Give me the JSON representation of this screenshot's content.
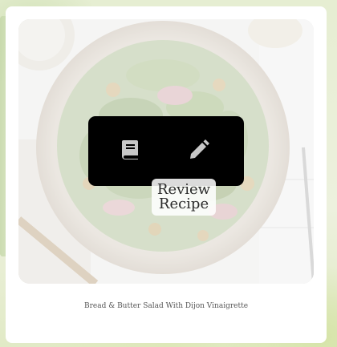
{
  "recipe": {
    "title": "Bread & Butter Salad With Dijon Vinaigrette"
  },
  "actions": {
    "review": {
      "icon": "book-icon",
      "tooltip_line1": "Review",
      "tooltip_line2": "Recipe"
    },
    "edit": {
      "icon": "pencil-icon"
    }
  },
  "colors": {
    "panel": "#000000",
    "icon": "#c8c8c8",
    "card": "#ffffff"
  }
}
